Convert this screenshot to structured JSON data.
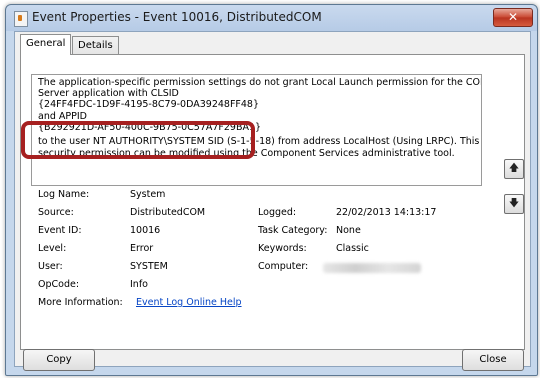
{
  "window": {
    "title": "Event Properties - Event 10016, DistributedCOM",
    "close_glyph": "✕"
  },
  "tabs": [
    {
      "label": "General"
    },
    {
      "label": "Details"
    }
  ],
  "description": {
    "lines": [
      "The application-specific permission settings do not grant Local Launch permission for the COM",
      "Server application with CLSID",
      "{24FF4FDC-1D9F-4195-8C79-0DA39248FF48}",
      " and APPID",
      "{B292921D-AF50-400C-9B75-0C57A7F29BA1}",
      " to the user NT AUTHORITY\\SYSTEM SID (S-1-5-18) from address LocalHost (Using LRPC). This",
      "security permission can be modified using the Component Services administrative tool."
    ]
  },
  "fields": {
    "log_name": {
      "label": "Log Name:",
      "value": "System"
    },
    "source": {
      "label": "Source:",
      "value": "DistributedCOM"
    },
    "event_id": {
      "label": "Event ID:",
      "value": "10016"
    },
    "level": {
      "label": "Level:",
      "value": "Error"
    },
    "user": {
      "label": "User:",
      "value": "SYSTEM"
    },
    "opcode": {
      "label": "OpCode:",
      "value": "Info"
    },
    "more_info": {
      "label": "More Information:",
      "value": "Event Log Online Help"
    },
    "logged": {
      "label": "Logged:",
      "value": "22/02/2013 14:13:17"
    },
    "task_category": {
      "label": "Task Category:",
      "value": "None"
    },
    "keywords": {
      "label": "Keywords:",
      "value": "Classic"
    },
    "computer": {
      "label": "Computer:",
      "value": ""
    }
  },
  "scroll": {
    "up_glyph": "🡅",
    "down_glyph": "🡇"
  },
  "buttons": {
    "copy": "Copy",
    "close": "Close"
  },
  "colors": {
    "highlight": "#a62020",
    "link": "#0645c5",
    "close_button": "#c8452f"
  }
}
